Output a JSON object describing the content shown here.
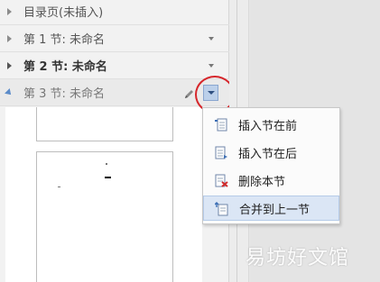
{
  "navigation": {
    "rows": [
      {
        "label": "目录页(未插入)"
      },
      {
        "label": "第 1 节: 未命名"
      },
      {
        "label": "第 2 节: 未命名"
      },
      {
        "label": "第 3 节: 未命名"
      }
    ]
  },
  "context_menu": {
    "items": [
      {
        "label": "插入节在前",
        "icon": "insert-section-before-icon"
      },
      {
        "label": "插入节在后",
        "icon": "insert-section-after-icon"
      },
      {
        "label": "删除本节",
        "icon": "delete-section-icon"
      },
      {
        "label": "合并到上一节",
        "icon": "merge-previous-icon"
      }
    ]
  },
  "watermark": {
    "text": "易坊好文馆"
  },
  "colors": {
    "highlight": "#dbe6f5",
    "annotation": "#d6262b",
    "accent": "#5b8bc9"
  }
}
